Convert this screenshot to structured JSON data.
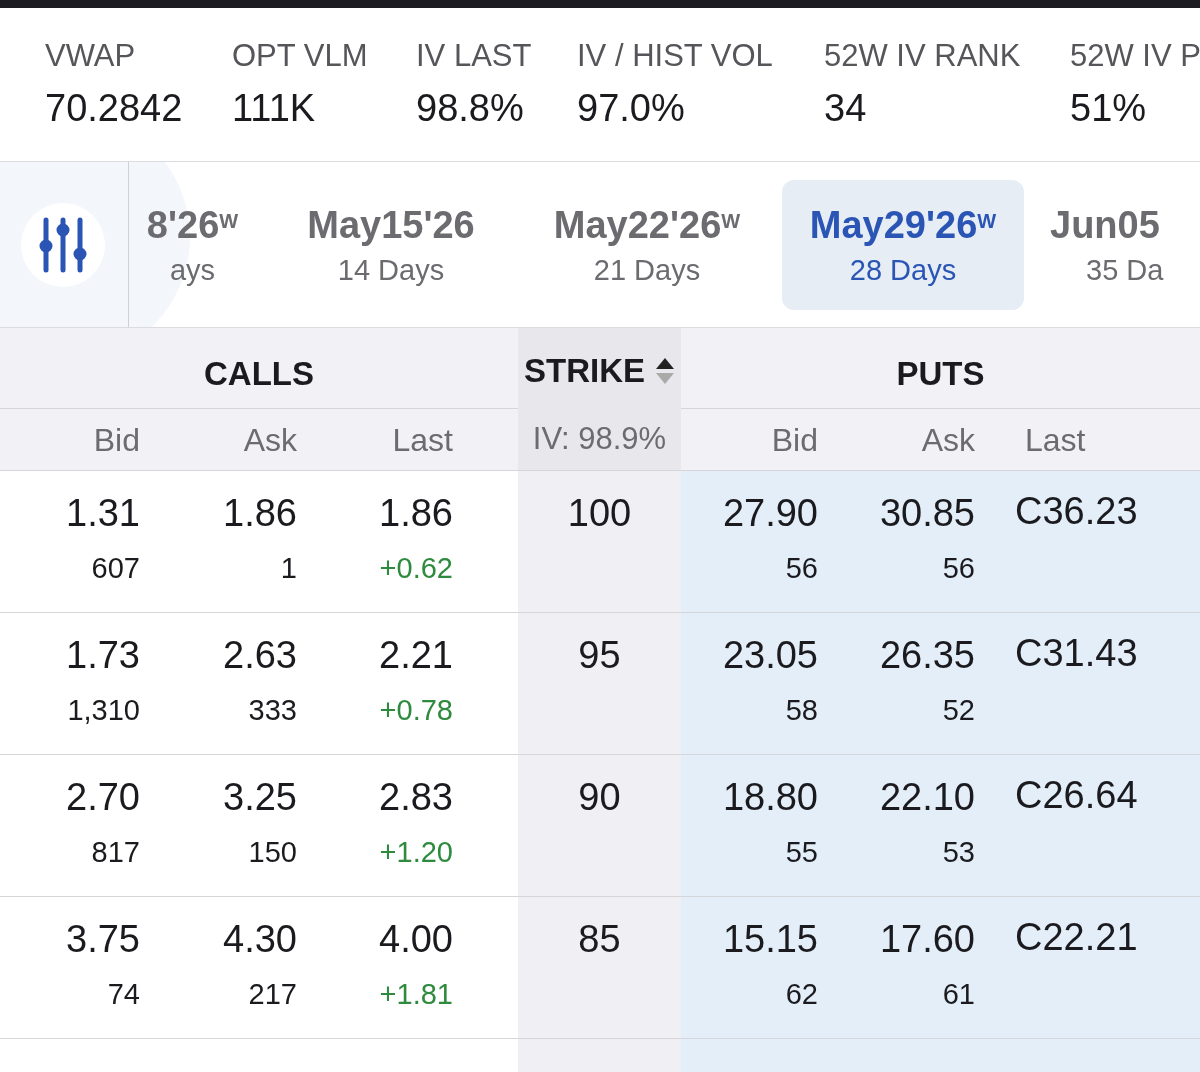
{
  "stats": [
    {
      "label": "VWAP",
      "value": "70.2842"
    },
    {
      "label": "OPT VLM",
      "value": "111K"
    },
    {
      "label": "IV LAST",
      "value": "98.8%"
    },
    {
      "label": "IV / HIST VOL",
      "value": "97.0%"
    },
    {
      "label": "52W IV RANK",
      "value": "34"
    },
    {
      "label": "52W IV P",
      "value": "51%"
    }
  ],
  "expirations": [
    {
      "label": "8'26",
      "suffix": "W",
      "days": "ays",
      "selected": false
    },
    {
      "label": "May15'26",
      "days": "14 Days",
      "selected": false
    },
    {
      "label": "May22'26",
      "suffix": "W",
      "days": "21 Days",
      "selected": false
    },
    {
      "label": "May29'26",
      "suffix": "W",
      "days": "28 Days",
      "selected": true
    },
    {
      "label": "Jun05",
      "days": "35 Da",
      "selected": false
    }
  ],
  "header": {
    "calls": "CALLS",
    "strike": "STRIKE",
    "sort_ascending": true,
    "puts": "PUTS",
    "iv": "IV: 98.9%",
    "call_columns": [
      "Bid",
      "Ask",
      "Last"
    ],
    "put_columns": [
      "Bid",
      "Ask",
      "Last"
    ]
  },
  "rows": [
    {
      "call_bid": "1.31",
      "call_bid_size": "607",
      "call_ask": "1.86",
      "call_ask_size": "1",
      "call_last": "1.86",
      "call_change": "+0.62",
      "strike": "100",
      "put_bid": "27.90",
      "put_bid_size": "56",
      "put_ask": "30.85",
      "put_ask_size": "56",
      "put_last": "C36.23"
    },
    {
      "call_bid": "1.73",
      "call_bid_size": "1,310",
      "call_ask": "2.63",
      "call_ask_size": "333",
      "call_last": "2.21",
      "call_change": "+0.78",
      "strike": "95",
      "put_bid": "23.05",
      "put_bid_size": "58",
      "put_ask": "26.35",
      "put_ask_size": "52",
      "put_last": "C31.43"
    },
    {
      "call_bid": "2.70",
      "call_bid_size": "817",
      "call_ask": "3.25",
      "call_ask_size": "150",
      "call_last": "2.83",
      "call_change": "+1.20",
      "strike": "90",
      "put_bid": "18.80",
      "put_bid_size": "55",
      "put_ask": "22.10",
      "put_ask_size": "53",
      "put_last": "C26.64"
    },
    {
      "call_bid": "3.75",
      "call_bid_size": "74",
      "call_ask": "4.30",
      "call_ask_size": "217",
      "call_last": "4.00",
      "call_change": "+1.81",
      "strike": "85",
      "put_bid": "15.15",
      "put_bid_size": "62",
      "put_ask": "17.60",
      "put_ask_size": "61",
      "put_last": "C22.21"
    }
  ]
}
